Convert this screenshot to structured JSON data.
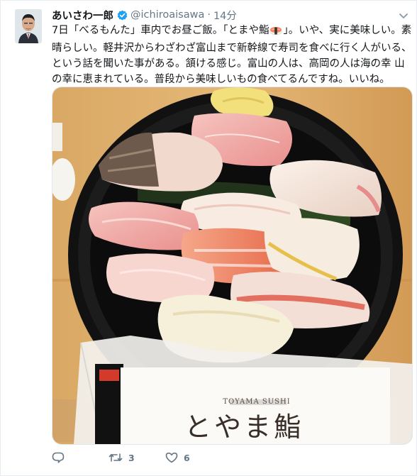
{
  "tweet": {
    "display_name": "あいさわ一郎",
    "handle": "@ichiroaisawa",
    "separator": "·",
    "timestamp": "14分",
    "text_before_emoji": "7日「べるもんた」車内でお昼ご飯。「とまや鮨",
    "text_after_emoji": "」。いや、実に美味しい。素晴らしい。軽井沢からわざわざ富山まで新幹線で寿司を食べに行く人がいる、という話を聞いた事がある。頷ける感じ。富山の人は、高岡の人は海の幸 山の幸に恵まれている。普段から美味しいもの食べてるんですね。いいね。",
    "emoji_name": "sushi-emoji"
  },
  "photo": {
    "package_label": "TOYAMA SUSHI",
    "package_brand": "とやま鮨",
    "image_name": "sushi-lunch-photo"
  },
  "actions": {
    "reply_count": "",
    "retweet_count": "3",
    "like_count": "6"
  },
  "colors": {
    "text": "#14171a",
    "secondary": "#657786",
    "verified": "#1da1f2",
    "border": "#e1e8ed"
  },
  "icons": [
    "verified-badge-icon",
    "caret-down-icon",
    "reply-icon",
    "retweet-icon",
    "like-icon"
  ]
}
